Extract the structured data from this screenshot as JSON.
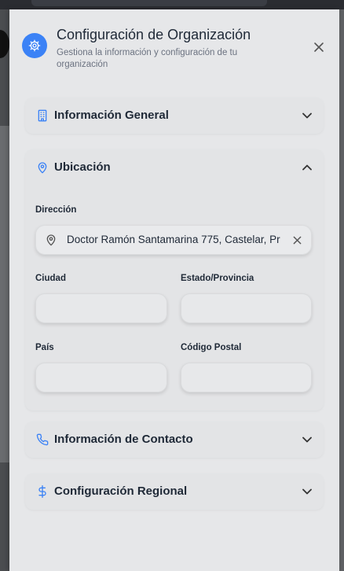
{
  "dialog": {
    "title": "Configuración de Organización",
    "subtitle": "Gestiona la información y configuración de tu organización"
  },
  "sections": {
    "general": {
      "label": "Información General",
      "icon": "building-icon",
      "expanded": false
    },
    "location": {
      "label": "Ubicación",
      "icon": "map-pin-icon",
      "expanded": true
    },
    "contact": {
      "label": "Información de Contacto",
      "icon": "phone-icon",
      "expanded": false
    },
    "regional": {
      "label": "Configuración Regional",
      "icon": "dollar-icon",
      "expanded": false
    }
  },
  "location_form": {
    "address_label": "Dirección",
    "address_value": "Doctor Ramón Santamarina 775, Castelar, Pr",
    "city_label": "Ciudad",
    "city_value": "",
    "state_label": "Estado/Provincia",
    "state_value": "",
    "country_label": "País",
    "country_value": "",
    "postal_label": "Código Postal",
    "postal_value": ""
  },
  "colors": {
    "accent": "#3b82f6",
    "panel": "#e6e7e9",
    "text": "#1f2937",
    "muted": "#6b7280"
  }
}
